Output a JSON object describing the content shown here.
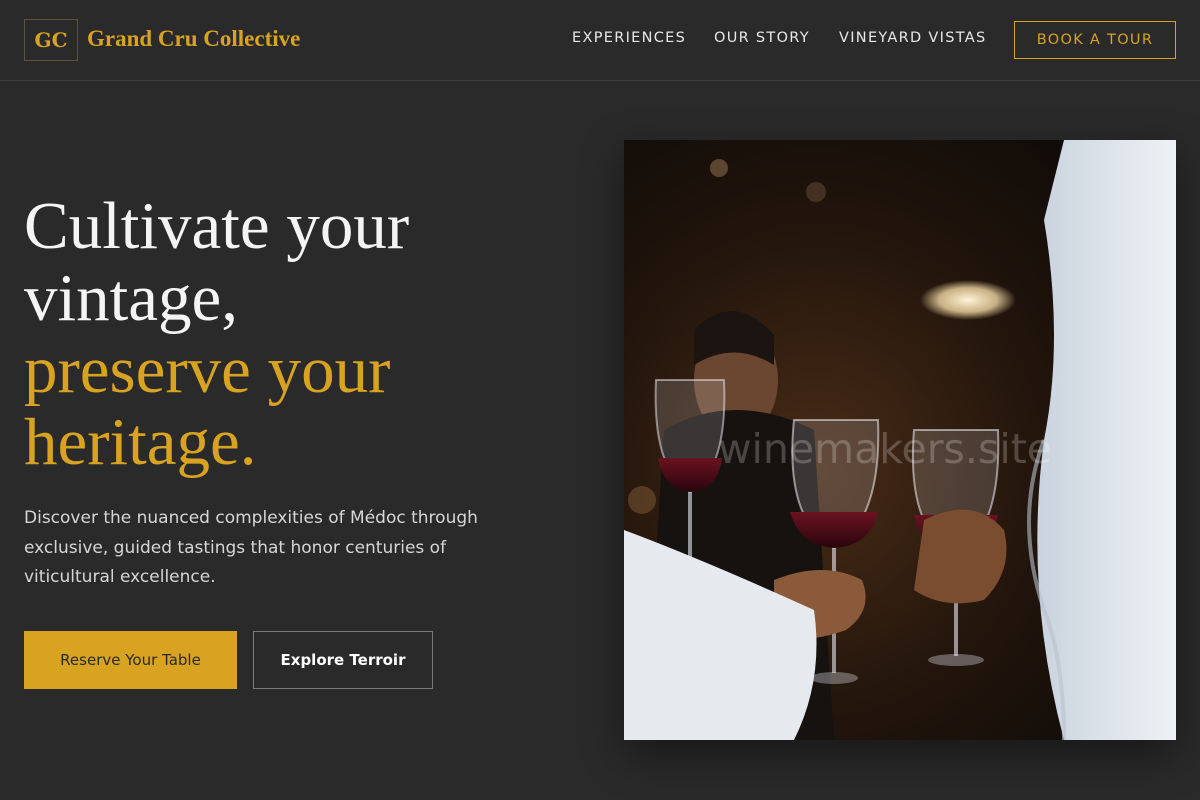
{
  "brand": {
    "monogram": "GC",
    "name": "Grand Cru Collective"
  },
  "nav": {
    "items": [
      "EXPERIENCES",
      "OUR STORY",
      "VINEYARD VISTAS"
    ],
    "cta": "BOOK A TOUR"
  },
  "hero": {
    "headline_line1": "Cultivate your",
    "headline_line2": "vintage,",
    "headline_line3": "preserve your",
    "headline_line4": "heritage.",
    "lead": "Discover the nuanced complexities of Médoc through exclusive, guided tastings that honor centuries of viticultural excellence.",
    "primary_button": "Reserve Your Table",
    "secondary_button": "Explore Terroir",
    "image_watermark": "winemakers.site"
  },
  "colors": {
    "background": "#2a2a2a",
    "accent_gold": "#d9a322",
    "text_light": "#f4f4f4"
  }
}
